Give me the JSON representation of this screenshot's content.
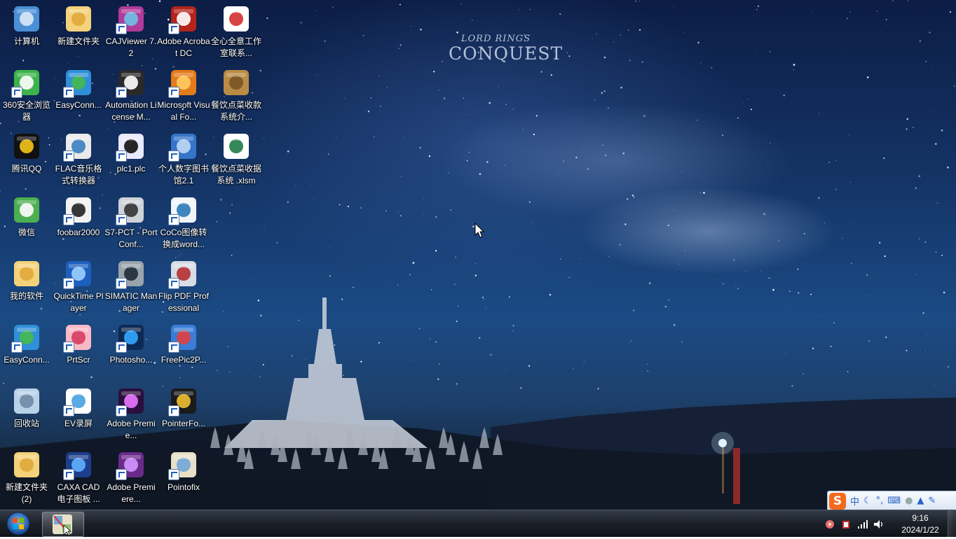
{
  "desktop": {
    "watermark": {
      "line1": "LORD RINGS",
      "line2": "CONQUEST"
    },
    "icons": [
      {
        "label": "计算机",
        "icon": "computer-icon"
      },
      {
        "label": "新建文件夹",
        "icon": "folder-icon"
      },
      {
        "label": "CAJViewer 7.2",
        "icon": "cajviewer-icon"
      },
      {
        "label": "Adobe Acrobat DC",
        "icon": "acrobat-icon"
      },
      {
        "label": "全心全意工作室联系...",
        "icon": "pdf-file-icon"
      },
      {
        "label": "360安全浏览器",
        "icon": "browser-360-icon"
      },
      {
        "label": "EasyConn...",
        "icon": "easyconnect-icon"
      },
      {
        "label": "Automation License M...",
        "icon": "license-manager-icon"
      },
      {
        "label": "Microsoft Visual Fo...",
        "icon": "visual-foxpro-icon"
      },
      {
        "label": "餐饮点菜收款系统介...",
        "icon": "archive-icon"
      },
      {
        "label": "腾讯QQ",
        "icon": "qq-penguin-icon"
      },
      {
        "label": "FLAC音乐格式转换器",
        "icon": "flac-converter-icon"
      },
      {
        "label": "plc1.plc",
        "icon": "plc-file-icon"
      },
      {
        "label": "个人数字图书馆2.1",
        "icon": "digital-library-icon"
      },
      {
        "label": "餐饮点菜收据系统 .xlsm",
        "icon": "excel-file-icon"
      },
      {
        "label": "微信",
        "icon": "wechat-icon"
      },
      {
        "label": "foobar2000",
        "icon": "foobar-icon"
      },
      {
        "label": "S7-PCT - Port Conf...",
        "icon": "s7-pct-icon"
      },
      {
        "label": "CoCo图像转换成word...",
        "icon": "coco-converter-icon"
      },
      {
        "label": "我的软件",
        "icon": "folder-icon"
      },
      {
        "label": "QuickTime Player",
        "icon": "quicktime-icon"
      },
      {
        "label": "SIMATIC Manager",
        "icon": "simatic-icon"
      },
      {
        "label": "Flip PDF Professional",
        "icon": "flip-pdf-icon"
      },
      {
        "label": "EasyConn...",
        "icon": "easyconnect-icon"
      },
      {
        "label": "PrtScr",
        "icon": "prtscr-icon"
      },
      {
        "label": "Photosho...",
        "icon": "photoshop-icon"
      },
      {
        "label": "FreePic2P...",
        "icon": "freepic2pdf-icon"
      },
      {
        "label": "回收站",
        "icon": "recycle-bin-icon"
      },
      {
        "label": "EV录屏",
        "icon": "ev-recorder-icon"
      },
      {
        "label": "Adobe Premie...",
        "icon": "premiere-icon"
      },
      {
        "label": "PointerFo...",
        "icon": "pointerfocus-icon"
      },
      {
        "label": "新建文件夹 (2)",
        "icon": "folder-icon"
      },
      {
        "label": "CAXA CAD 电子图板 ...",
        "icon": "caxa-cad-icon"
      },
      {
        "label": "Adobe Premiere...",
        "icon": "premiere-elements-icon"
      },
      {
        "label": "Pointofix",
        "icon": "pointofix-icon"
      }
    ]
  },
  "ime_bar": {
    "logo": "S",
    "mode": "中"
  },
  "taskbar": {
    "clock_time": "9:16",
    "clock_date": "2024/1/22"
  }
}
